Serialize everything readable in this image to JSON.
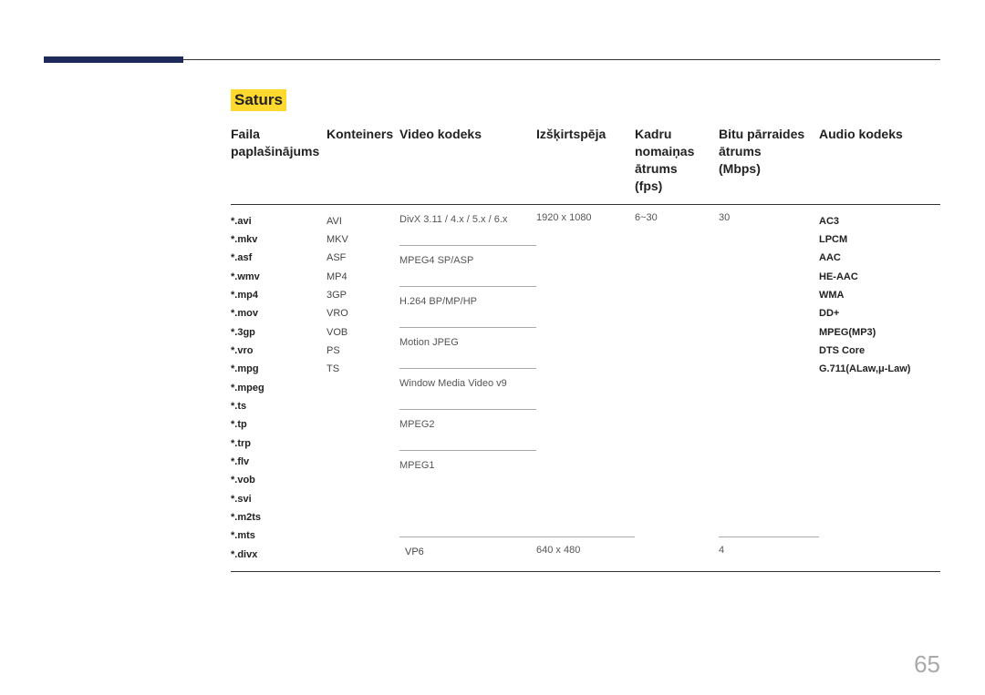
{
  "title": "Saturs",
  "page_number": "65",
  "headers": {
    "ext": "Faila paplašinājums",
    "container": "Konteiners",
    "vcodec": "Video kodeks",
    "resolution": "Izšķirtspēja",
    "fps": "Kadru nomaiņas ātrums",
    "fps_unit": "(fps)",
    "bitrate": "Bitu pārraides ātrums",
    "bitrate_unit": "(Mbps)",
    "acodec": "Audio kodeks"
  },
  "extensions": [
    "*.avi",
    "*.mkv",
    "*.asf",
    "*.wmv",
    "*.mp4",
    "*.mov",
    "*.3gp",
    "*.vro",
    "*.mpg",
    "*.mpeg",
    "*.ts",
    "*.tp",
    "*.trp",
    "*.flv",
    "*.vob",
    "*.svi",
    "*.m2ts",
    "*.mts",
    "*.divx"
  ],
  "containers": [
    "AVI",
    "MKV",
    "ASF",
    "MP4",
    "3GP",
    "VRO",
    "VOB",
    "PS",
    "TS"
  ],
  "video_codecs": [
    "DivX 3.11 / 4.x / 5.x / 6.x",
    "MPEG4 SP/ASP",
    "H.264 BP/MP/HP",
    "Motion JPEG",
    "Window Media Video v9",
    "MPEG2",
    "MPEG1"
  ],
  "vp6": "VP6",
  "res_main": "1920 x 1080",
  "res_vp6": "640 x 480",
  "fps_main": "6~30",
  "mbps_main": "30",
  "mbps_vp6": "4",
  "audio_codecs": [
    "AC3",
    "LPCM",
    "AAC",
    "HE-AAC",
    "WMA",
    "DD+",
    "MPEG(MP3)",
    "DTS Core",
    "G.711(ALaw,μ-Law)"
  ]
}
